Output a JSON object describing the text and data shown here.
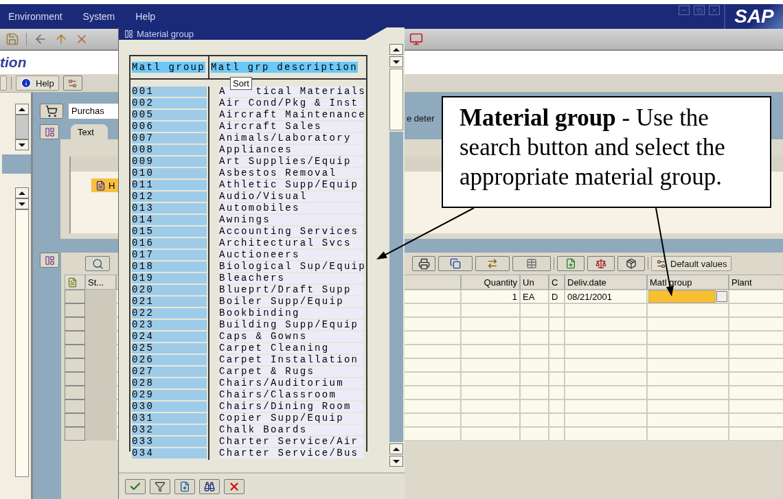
{
  "menu_bar": {
    "items": [
      {
        "label": "Environment"
      },
      {
        "label": "System"
      },
      {
        "label": "Help"
      }
    ],
    "logo": "SAP"
  },
  "screen_title": "tion",
  "app_toolbar": {
    "help_button": "Help"
  },
  "header": {
    "field_value": "Purchas",
    "note": "e deter",
    "tab": "Text",
    "item": "H"
  },
  "items_table": {
    "toolbar_button": "Default values",
    "columns": [
      "St...",
      "Quantity",
      "Un",
      "C",
      "Deliv.date",
      "Matl group",
      "Plant"
    ],
    "rows": [
      {
        "quantity": "1",
        "unit": "EA",
        "category": "D",
        "delivery_date": "08/21/2001",
        "matl_group_focused": true
      }
    ]
  },
  "dialog": {
    "title": "Material group",
    "columns": [
      "Matl group",
      "Matl grp description"
    ],
    "tooltip": "Sort",
    "rows": [
      {
        "code": "001",
        "description": "A    tical Materials"
      },
      {
        "code": "002",
        "description": "Air Cond/Pkg & Inst"
      },
      {
        "code": "005",
        "description": "Aircraft Maintenance"
      },
      {
        "code": "006",
        "description": "Aircraft Sales"
      },
      {
        "code": "007",
        "description": "Animals/Laboratory"
      },
      {
        "code": "008",
        "description": "Appliances"
      },
      {
        "code": "009",
        "description": "Art Supplies/Equip"
      },
      {
        "code": "010",
        "description": "Asbestos Removal"
      },
      {
        "code": "011",
        "description": "Athletic Supp/Equip"
      },
      {
        "code": "012",
        "description": "Audio/Visual"
      },
      {
        "code": "013",
        "description": "Automobiles"
      },
      {
        "code": "014",
        "description": "Awnings"
      },
      {
        "code": "015",
        "description": "Accounting Services"
      },
      {
        "code": "016",
        "description": "Architectural Svcs"
      },
      {
        "code": "017",
        "description": "Auctioneers"
      },
      {
        "code": "018",
        "description": "Biological Sup/Equip"
      },
      {
        "code": "019",
        "description": "Bleachers"
      },
      {
        "code": "020",
        "description": "Blueprt/Draft Supp"
      },
      {
        "code": "021",
        "description": "Boiler Supp/Equip"
      },
      {
        "code": "022",
        "description": "Bookbinding"
      },
      {
        "code": "023",
        "description": "Building Supp/Equip"
      },
      {
        "code": "024",
        "description": "Caps & Gowns"
      },
      {
        "code": "025",
        "description": "Carpet Cleaning"
      },
      {
        "code": "026",
        "description": "Carpet Installation"
      },
      {
        "code": "027",
        "description": "Carpet & Rugs"
      },
      {
        "code": "028",
        "description": "Chairs/Auditorium"
      },
      {
        "code": "029",
        "description": "Chairs/Classroom"
      },
      {
        "code": "030",
        "description": "Chairs/Dining Room"
      },
      {
        "code": "031",
        "description": "Copier Supp/Equip"
      },
      {
        "code": "032",
        "description": "Chalk Boards"
      },
      {
        "code": "033",
        "description": "Charter Service/Air"
      },
      {
        "code": "034",
        "description": "Charter Service/Bus"
      }
    ]
  },
  "callout": {
    "text": "**Material group** - Use the search button and select the appropriate material group."
  }
}
